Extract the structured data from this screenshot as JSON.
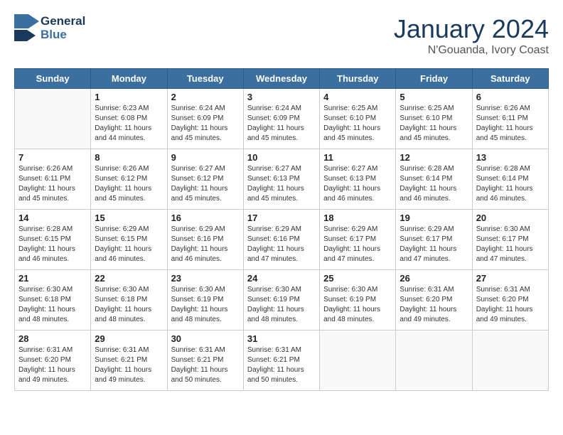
{
  "header": {
    "logo_general": "General",
    "logo_blue": "Blue",
    "month": "January 2024",
    "location": "N'Gouanda, Ivory Coast"
  },
  "weekdays": [
    "Sunday",
    "Monday",
    "Tuesday",
    "Wednesday",
    "Thursday",
    "Friday",
    "Saturday"
  ],
  "weeks": [
    [
      {
        "day": "",
        "info": ""
      },
      {
        "day": "1",
        "info": "Sunrise: 6:23 AM\nSunset: 6:08 PM\nDaylight: 11 hours\nand 44 minutes."
      },
      {
        "day": "2",
        "info": "Sunrise: 6:24 AM\nSunset: 6:09 PM\nDaylight: 11 hours\nand 45 minutes."
      },
      {
        "day": "3",
        "info": "Sunrise: 6:24 AM\nSunset: 6:09 PM\nDaylight: 11 hours\nand 45 minutes."
      },
      {
        "day": "4",
        "info": "Sunrise: 6:25 AM\nSunset: 6:10 PM\nDaylight: 11 hours\nand 45 minutes."
      },
      {
        "day": "5",
        "info": "Sunrise: 6:25 AM\nSunset: 6:10 PM\nDaylight: 11 hours\nand 45 minutes."
      },
      {
        "day": "6",
        "info": "Sunrise: 6:26 AM\nSunset: 6:11 PM\nDaylight: 11 hours\nand 45 minutes."
      }
    ],
    [
      {
        "day": "7",
        "info": "Sunrise: 6:26 AM\nSunset: 6:11 PM\nDaylight: 11 hours\nand 45 minutes."
      },
      {
        "day": "8",
        "info": "Sunrise: 6:26 AM\nSunset: 6:12 PM\nDaylight: 11 hours\nand 45 minutes."
      },
      {
        "day": "9",
        "info": "Sunrise: 6:27 AM\nSunset: 6:12 PM\nDaylight: 11 hours\nand 45 minutes."
      },
      {
        "day": "10",
        "info": "Sunrise: 6:27 AM\nSunset: 6:13 PM\nDaylight: 11 hours\nand 45 minutes."
      },
      {
        "day": "11",
        "info": "Sunrise: 6:27 AM\nSunset: 6:13 PM\nDaylight: 11 hours\nand 46 minutes."
      },
      {
        "day": "12",
        "info": "Sunrise: 6:28 AM\nSunset: 6:14 PM\nDaylight: 11 hours\nand 46 minutes."
      },
      {
        "day": "13",
        "info": "Sunrise: 6:28 AM\nSunset: 6:14 PM\nDaylight: 11 hours\nand 46 minutes."
      }
    ],
    [
      {
        "day": "14",
        "info": "Sunrise: 6:28 AM\nSunset: 6:15 PM\nDaylight: 11 hours\nand 46 minutes."
      },
      {
        "day": "15",
        "info": "Sunrise: 6:29 AM\nSunset: 6:15 PM\nDaylight: 11 hours\nand 46 minutes."
      },
      {
        "day": "16",
        "info": "Sunrise: 6:29 AM\nSunset: 6:16 PM\nDaylight: 11 hours\nand 46 minutes."
      },
      {
        "day": "17",
        "info": "Sunrise: 6:29 AM\nSunset: 6:16 PM\nDaylight: 11 hours\nand 47 minutes."
      },
      {
        "day": "18",
        "info": "Sunrise: 6:29 AM\nSunset: 6:17 PM\nDaylight: 11 hours\nand 47 minutes."
      },
      {
        "day": "19",
        "info": "Sunrise: 6:29 AM\nSunset: 6:17 PM\nDaylight: 11 hours\nand 47 minutes."
      },
      {
        "day": "20",
        "info": "Sunrise: 6:30 AM\nSunset: 6:17 PM\nDaylight: 11 hours\nand 47 minutes."
      }
    ],
    [
      {
        "day": "21",
        "info": "Sunrise: 6:30 AM\nSunset: 6:18 PM\nDaylight: 11 hours\nand 48 minutes."
      },
      {
        "day": "22",
        "info": "Sunrise: 6:30 AM\nSunset: 6:18 PM\nDaylight: 11 hours\nand 48 minutes."
      },
      {
        "day": "23",
        "info": "Sunrise: 6:30 AM\nSunset: 6:19 PM\nDaylight: 11 hours\nand 48 minutes."
      },
      {
        "day": "24",
        "info": "Sunrise: 6:30 AM\nSunset: 6:19 PM\nDaylight: 11 hours\nand 48 minutes."
      },
      {
        "day": "25",
        "info": "Sunrise: 6:30 AM\nSunset: 6:19 PM\nDaylight: 11 hours\nand 48 minutes."
      },
      {
        "day": "26",
        "info": "Sunrise: 6:31 AM\nSunset: 6:20 PM\nDaylight: 11 hours\nand 49 minutes."
      },
      {
        "day": "27",
        "info": "Sunrise: 6:31 AM\nSunset: 6:20 PM\nDaylight: 11 hours\nand 49 minutes."
      }
    ],
    [
      {
        "day": "28",
        "info": "Sunrise: 6:31 AM\nSunset: 6:20 PM\nDaylight: 11 hours\nand 49 minutes."
      },
      {
        "day": "29",
        "info": "Sunrise: 6:31 AM\nSunset: 6:21 PM\nDaylight: 11 hours\nand 49 minutes."
      },
      {
        "day": "30",
        "info": "Sunrise: 6:31 AM\nSunset: 6:21 PM\nDaylight: 11 hours\nand 50 minutes."
      },
      {
        "day": "31",
        "info": "Sunrise: 6:31 AM\nSunset: 6:21 PM\nDaylight: 11 hours\nand 50 minutes."
      },
      {
        "day": "",
        "info": ""
      },
      {
        "day": "",
        "info": ""
      },
      {
        "day": "",
        "info": ""
      }
    ]
  ]
}
